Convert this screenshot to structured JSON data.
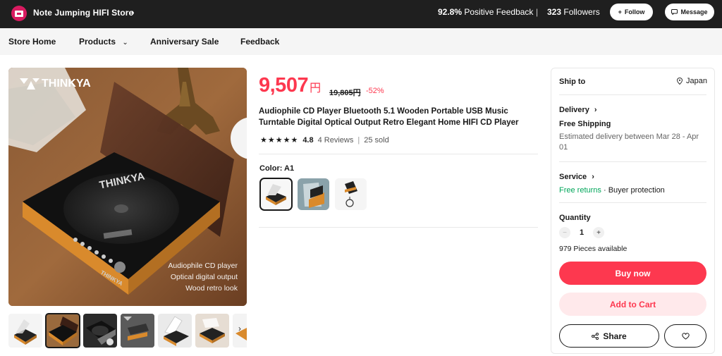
{
  "store": {
    "name": "Note Jumping HIFI Store",
    "feedback_pct": "92.8%",
    "feedback_label": "Positive Feedback",
    "separator": "|",
    "followers_count": "323",
    "followers_label": "Followers",
    "follow_label": "Follow",
    "message_label": "Message"
  },
  "nav": {
    "store_home": "Store Home",
    "products": "Products",
    "anniversary_sale": "Anniversary Sale",
    "feedback": "Feedback"
  },
  "gallery": {
    "brand": "THINKYA",
    "disc_brand": "THINKYA",
    "device_brand": "THINKYA",
    "overlay_lines": [
      "Audiophile CD player",
      "Optical digital output",
      "Wood retro look"
    ],
    "thumbnail_count": 6,
    "active_thumbnail": 2
  },
  "product": {
    "price": "9,507",
    "currency": "円",
    "original_price": "19,805円",
    "discount": "-52%",
    "title": "Audiophile CD Player Bluetooth 5.1 Wooden Portable USB Music Turntable Digital Optical Output Retro Elegant Home HIFI CD Player",
    "rating": "4.8",
    "rating_stars": 5,
    "reviews": "4 Reviews",
    "rating_separator": "|",
    "sold": "25 sold",
    "color_label": "Color: A1",
    "swatch_count": 3,
    "selected_swatch": 1
  },
  "side": {
    "ship_to_label": "Ship to",
    "ship_to_value": "Japan",
    "delivery_label": "Delivery",
    "free_shipping": "Free Shipping",
    "estimated_delivery": "Estimated delivery between Mar 28 - Apr 01",
    "service_label": "Service",
    "free_returns": "Free returns",
    "buyer_protection": "· Buyer protection",
    "quantity_label": "Quantity",
    "quantity_minus": "−",
    "quantity_value": "1",
    "quantity_plus": "+",
    "pieces_available": "979 Pieces available",
    "buy_now": "Buy now",
    "add_to_cart": "Add to Cart",
    "share": "Share"
  },
  "colors": {
    "accent": "#fd384f",
    "accent_light": "#ffe9eb",
    "topbar": "#1f1f1f",
    "success": "#00a65a",
    "wood": "#d98a2c"
  }
}
